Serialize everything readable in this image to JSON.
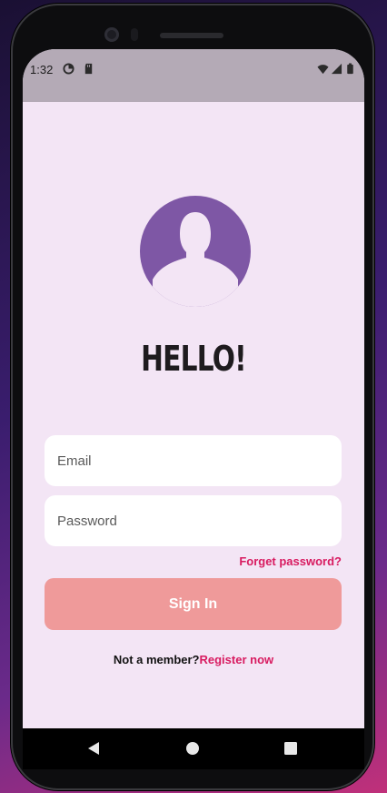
{
  "status_bar": {
    "time": "1:32",
    "left_icons": [
      "data-saver-icon",
      "sd-card-icon"
    ],
    "right_icons": [
      "wifi-icon",
      "signal-icon",
      "battery-icon"
    ]
  },
  "login": {
    "title": "HELLO!",
    "email_placeholder": "Email",
    "password_placeholder": "Password",
    "forgot_label": "Forget password?",
    "sign_in_label": "Sign In",
    "not_member_text": "Not a member?",
    "register_label": "Register now"
  },
  "colors": {
    "background": "#f3e5f5",
    "avatar": "#7e57a5",
    "accent": "#d81b60",
    "button": "#ef9a9a"
  }
}
